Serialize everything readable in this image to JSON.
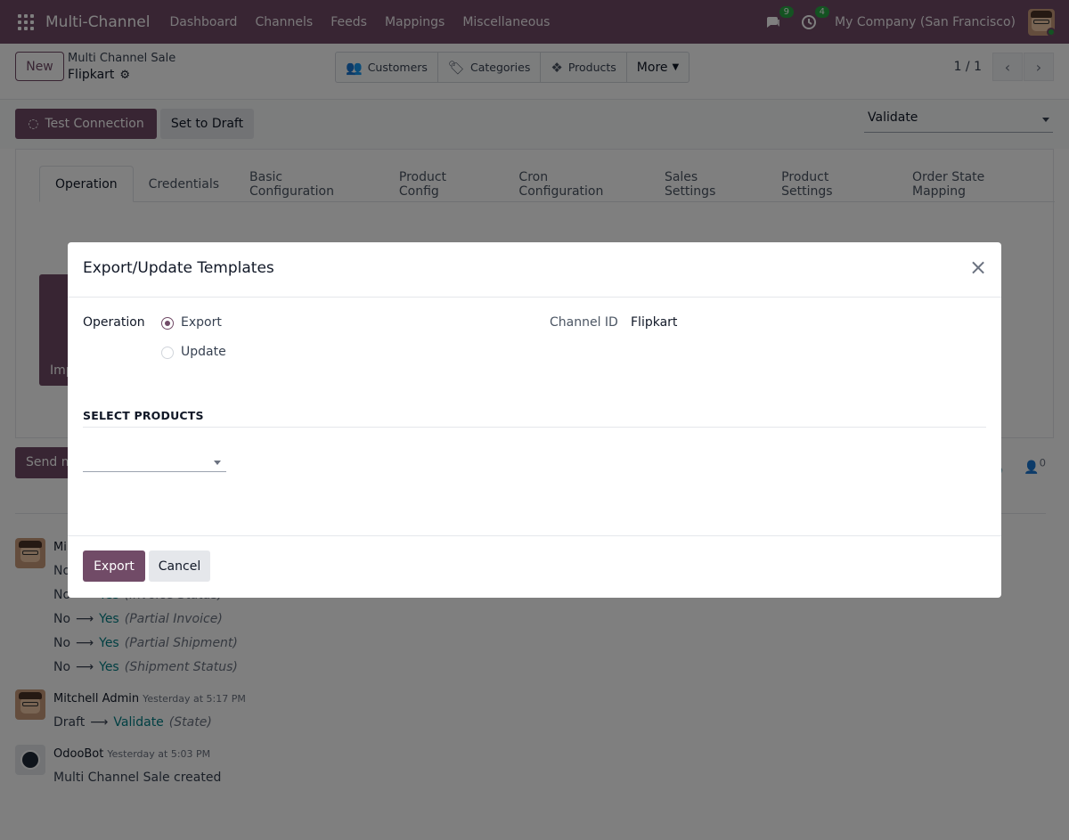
{
  "topbar": {
    "app_name": "Multi-Channel",
    "menu": [
      "Dashboard",
      "Channels",
      "Feeds",
      "Mappings",
      "Miscellaneous"
    ],
    "messages_count": "9",
    "activities_count": "4",
    "company": "My Company (San Francisco)"
  },
  "control_panel": {
    "new_label": "New",
    "breadcrumb_parent": "Multi Channel Sale",
    "breadcrumb_current": "Flipkart",
    "smart_buttons": [
      "Customers",
      "Categories",
      "Products"
    ],
    "more_label": "More",
    "pager": "1 / 1"
  },
  "statusbar": {
    "test_connection": "Test Connection",
    "set_to_draft": "Set to Draft",
    "state": "Validate"
  },
  "tabs": [
    "Operation",
    "Credentials",
    "Basic Configuration",
    "Product Config",
    "Cron Configuration",
    "Sales Settings",
    "Product Settings",
    "Order State Mapping"
  ],
  "background": {
    "import_label": "Imp",
    "send_label": "Send m",
    "followers_count": "0"
  },
  "chatter": {
    "messages": [
      {
        "author": "Mi",
        "tracking": [
          {
            "old": "No",
            "new": "",
            "field": ""
          },
          {
            "old": "No",
            "new": "Yes",
            "field": "(Invoice Status)"
          },
          {
            "old": "No",
            "new": "Yes",
            "field": "(Partial Invoice)"
          },
          {
            "old": "No",
            "new": "Yes",
            "field": "(Partial Shipment)"
          },
          {
            "old": "No",
            "new": "Yes",
            "field": "(Shipment Status)"
          }
        ]
      },
      {
        "author": "Mitchell Admin",
        "time": "Yesterday at 5:17 PM",
        "tracking": [
          {
            "old": "Draft",
            "new": "Validate",
            "field": "(State)"
          }
        ]
      },
      {
        "author": "OdooBot",
        "time": "Yesterday at 5:03 PM",
        "body": "Multi Channel Sale created"
      }
    ]
  },
  "modal": {
    "title": "Export/Update Templates",
    "operation_label": "Operation",
    "options": [
      "Export",
      "Update"
    ],
    "selected_option": "Export",
    "channel_label": "Channel ID",
    "channel_value": "Flipkart",
    "section_title": "SELECT PRODUCTS",
    "export_button": "Export",
    "cancel_button": "Cancel"
  },
  "colors": {
    "brand": "#714b67",
    "success": "#28a745",
    "link": "#017e84"
  }
}
